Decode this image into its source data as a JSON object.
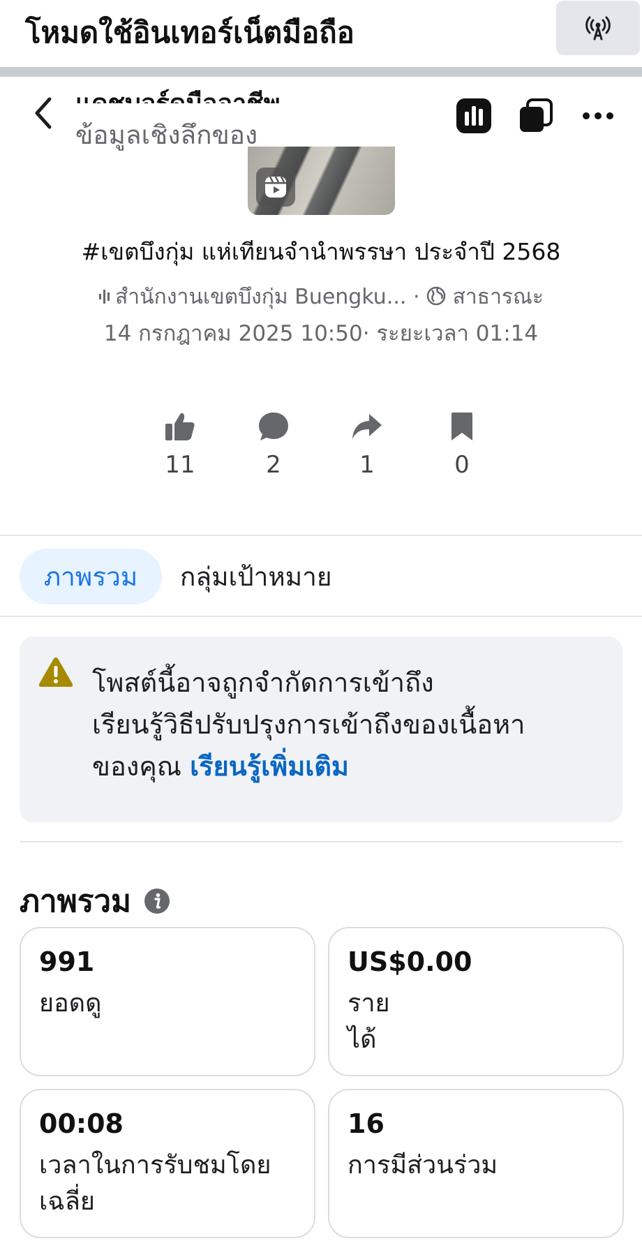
{
  "banner": {
    "title": "โหมดใช้อินเทอร์เน็ตมือถือ",
    "icon": "broadcast-antenna-icon"
  },
  "header": {
    "title": "แดชบอร์ดมืออาชีพ",
    "subtitle": "ข้อมูลเชิงลึกของ",
    "icons": [
      "back-arrow-icon",
      "bar-chart-icon",
      "copy-icon",
      "more-icon"
    ]
  },
  "post": {
    "thumbnail_badge": "reels-icon",
    "title": "#เขตบึงกุ่ม แห่เทียนจำนำพรรษา ประจำปี 2568",
    "author": "สำนักงานเขตบึงกุ่ม Buengku...",
    "separator": "·",
    "audience": "สาธารณะ",
    "date": "14 กรกฎาคม  2025 10:50",
    "duration_label": "ระยะเวลา 01:14",
    "stats": [
      {
        "icon": "like-icon",
        "value": "11"
      },
      {
        "icon": "comment-icon",
        "value": "2"
      },
      {
        "icon": "share-icon",
        "value": "1"
      },
      {
        "icon": "bookmark-icon",
        "value": "0"
      }
    ]
  },
  "tabs": {
    "active": "ภาพรวม",
    "other": "กลุ่มเป้าหมาย"
  },
  "notice": {
    "line1": "โพสต์นี้อาจถูกจำกัดการเข้าถึง",
    "line2": "เรียนรู้วิธีปรับปรุงการเข้าถึงของเนื้อหา",
    "line3_prefix": "ของคุณ ",
    "link": "เรียนรู้เพิ่มเติม"
  },
  "overview": {
    "title": "ภาพรวม",
    "cards": [
      {
        "value": "991",
        "label": "ยอดดู"
      },
      {
        "value": "US$0.00",
        "label": "รายได้"
      },
      {
        "value": "00:08",
        "label": "เวลาในการรับชมโดยเฉลี่ย"
      },
      {
        "value": "16",
        "label": "การมีส่วนร่วม"
      }
    ]
  },
  "colors": {
    "accent": "#1b74e4",
    "link": "#0a66c2",
    "warning": "#a88a00",
    "muted": "#65676b"
  }
}
